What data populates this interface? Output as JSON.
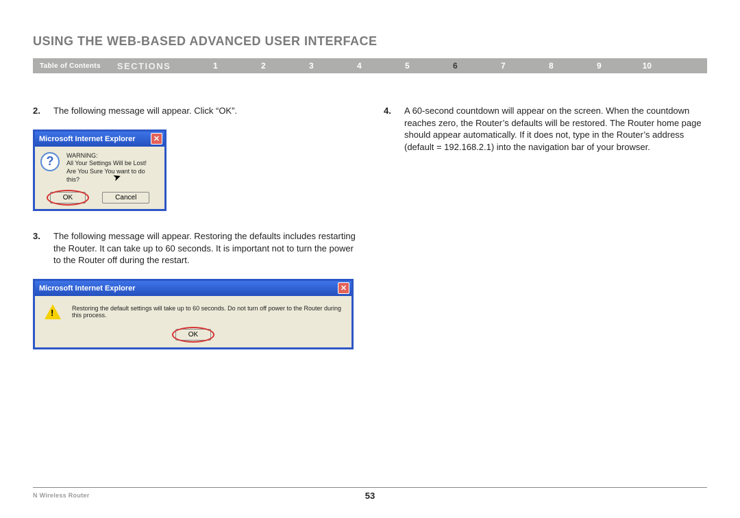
{
  "header": {
    "title": "USING THE WEB-BASED ADVANCED USER INTERFACE"
  },
  "nav": {
    "toc": "Table of Contents",
    "sections_label": "SECTIONS",
    "items": [
      "1",
      "2",
      "3",
      "4",
      "5",
      "6",
      "7",
      "8",
      "9",
      "10"
    ],
    "active": "6"
  },
  "steps": {
    "s2": {
      "num": "2.",
      "text": "The following message will appear. Click “OK”."
    },
    "s3": {
      "num": "3.",
      "text": "The following message will appear. Restoring the defaults includes restarting the Router. It can take up to 60 seconds. It is important not to turn the power to the Router off during the restart."
    },
    "s4": {
      "num": "4.",
      "text": "A 60-second countdown will appear on the screen. When the countdown reaches zero, the Router’s defaults will be restored. The Router home page should appear automatically. If it does not, type in the Router’s address (default = 192.168.2.1) into the navigation bar of your browser."
    }
  },
  "dialog1": {
    "title": "Microsoft Internet Explorer",
    "line1": "WARNING:",
    "line2": "All Your Settings Will be Lost!",
    "line3": "Are You Sure You want to do this?",
    "ok": "OK",
    "cancel": "Cancel"
  },
  "dialog2": {
    "title": "Microsoft Internet Explorer",
    "msg": "Restoring the default settings will take up to 60 seconds. Do not turn off power to the Router during this process.",
    "ok": "OK"
  },
  "footer": {
    "product": "N Wireless Router",
    "page": "53"
  }
}
